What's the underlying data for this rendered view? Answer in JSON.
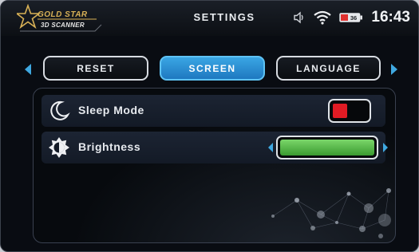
{
  "header": {
    "title": "SETTINGS",
    "time": "16:43",
    "battery_label": "36"
  },
  "logo": {
    "line1": "GOLD STAR",
    "line2": "3D SCANNER"
  },
  "tabs": [
    {
      "label": "RESET",
      "active": false
    },
    {
      "label": "SCREEN",
      "active": true
    },
    {
      "label": "LANGUAGE",
      "active": false
    }
  ],
  "settings": {
    "sleep_mode": {
      "label": "Sleep Mode",
      "icon": "moon-icon",
      "enabled": false
    },
    "brightness": {
      "label": "Brightness",
      "icon": "brightness-icon",
      "level": 1.0
    }
  },
  "colors": {
    "accent": "#3fa8e0",
    "active_tab": "#2b8fd3",
    "toggle_off": "#e01b24",
    "brightness_fill": "#5cc04c",
    "logo_gold": "#d8b156"
  }
}
